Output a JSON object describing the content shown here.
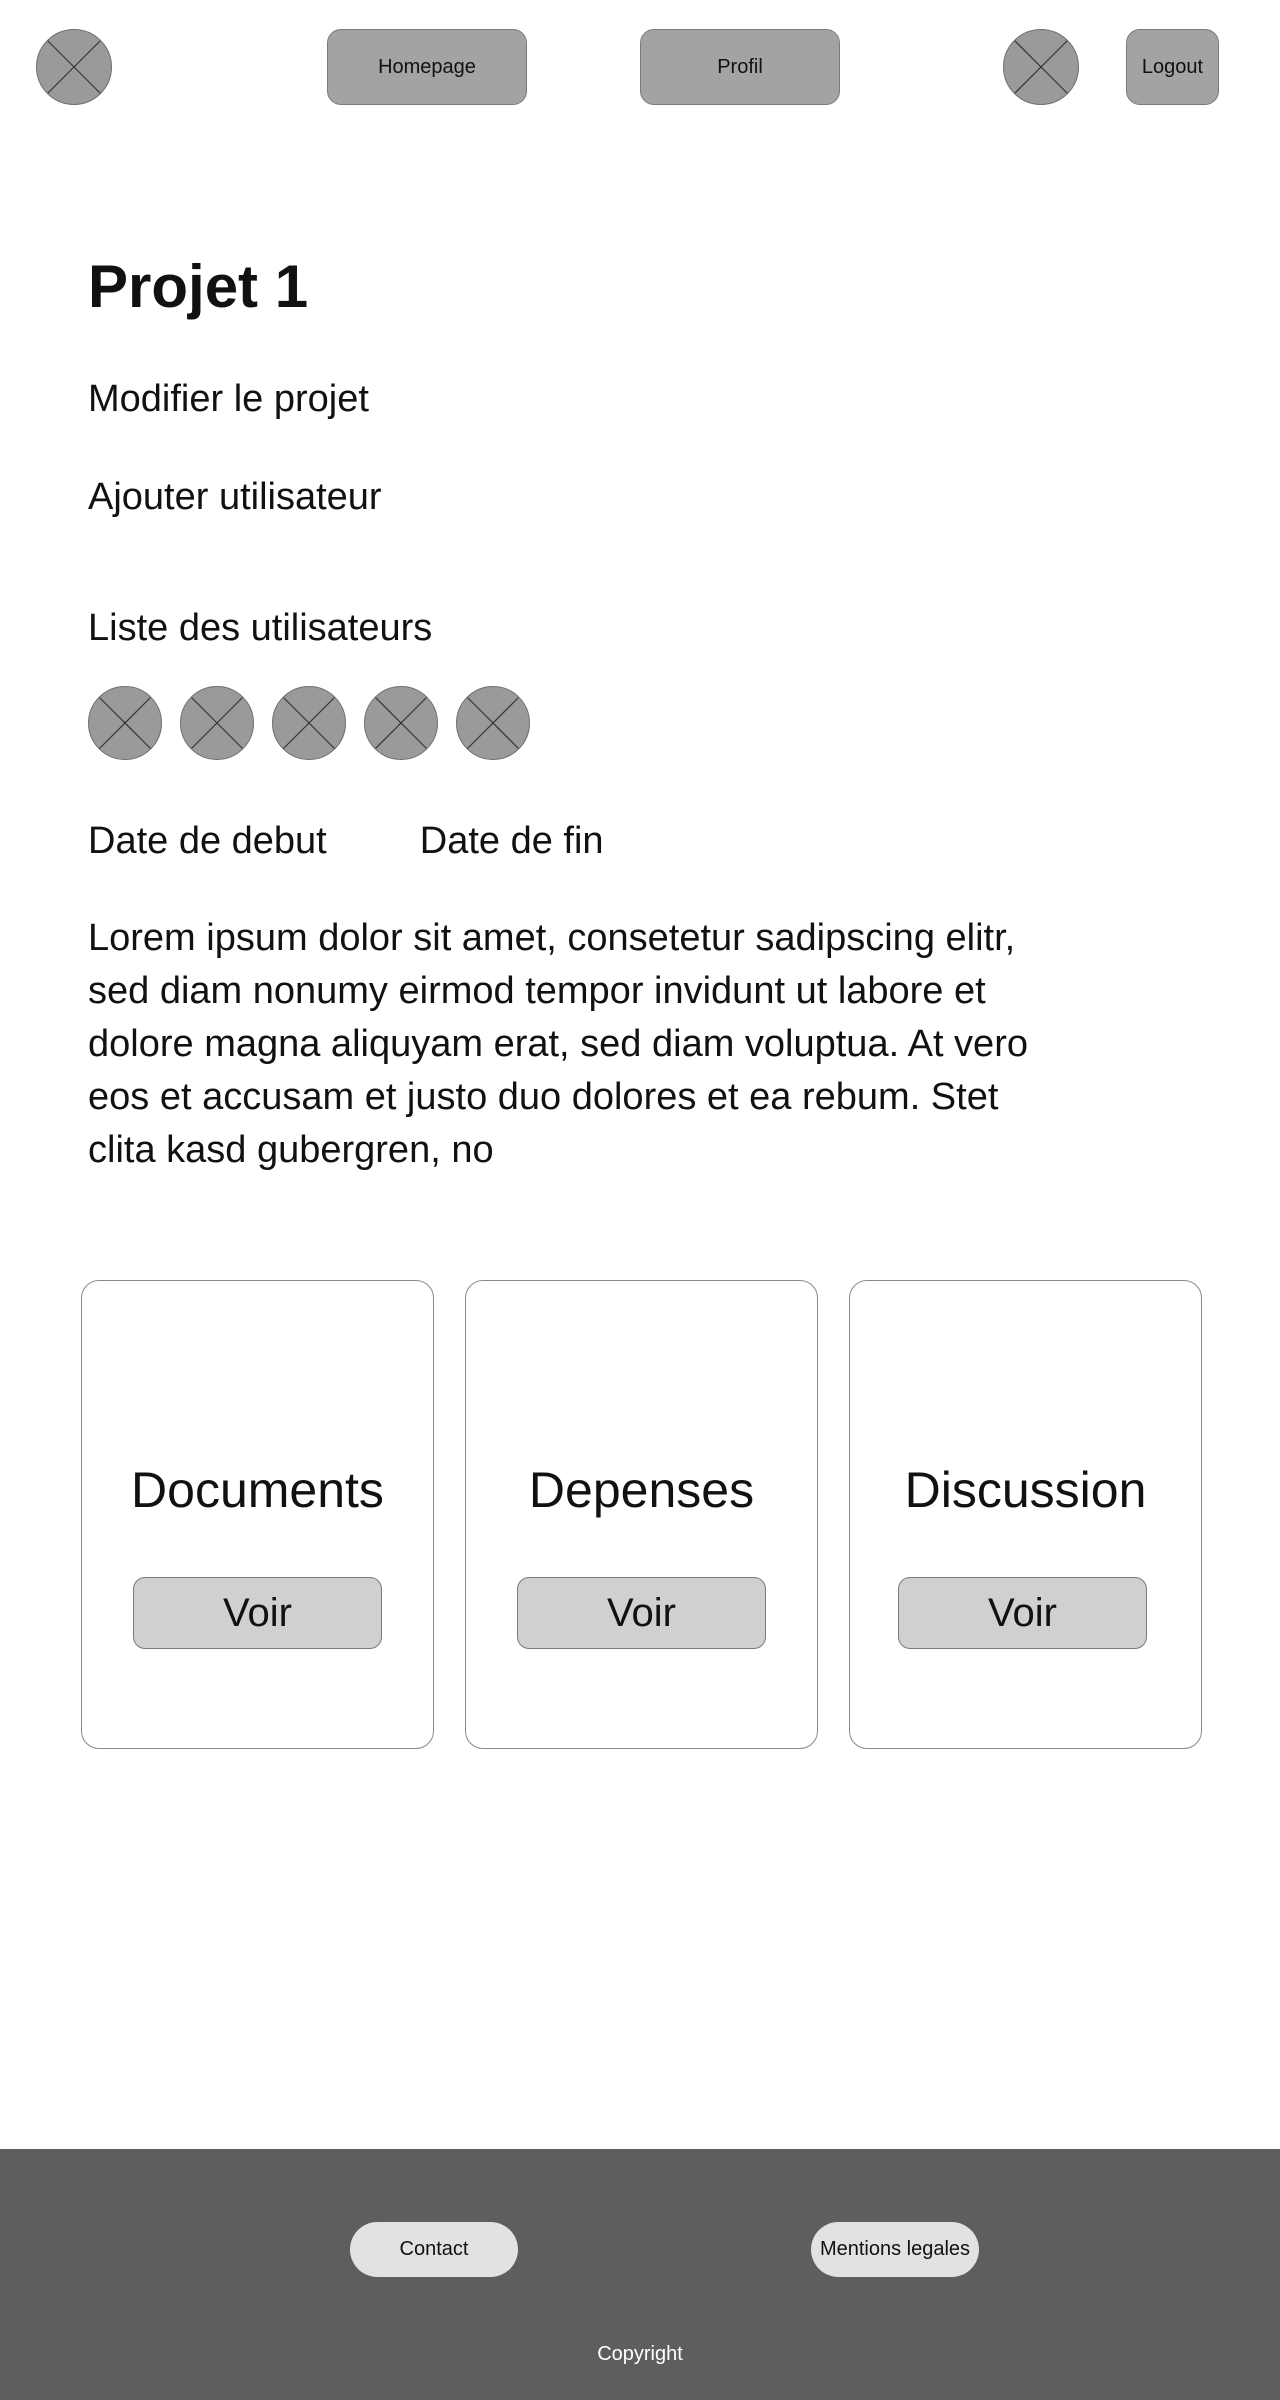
{
  "header": {
    "logo_icon": "image-placeholder-icon",
    "nav": {
      "homepage": "Homepage",
      "profil": "Profil"
    },
    "avatar_icon": "image-placeholder-icon",
    "logout": "Logout"
  },
  "project": {
    "title": "Projet 1",
    "edit_link": "Modifier le projet",
    "add_user_link": "Ajouter utilisateur",
    "users_heading": "Liste des utilisateurs",
    "users_count_shown": 5,
    "start_date_label": "Date de debut",
    "end_date_label": "Date de fin",
    "description": "Lorem ipsum dolor sit amet, consetetur sadipscing elitr, sed diam nonumy eirmod tempor invidunt ut labore et dolore magna aliquyam erat, sed diam voluptua. At vero eos et accusam et justo duo dolores et ea rebum. Stet clita kasd gubergren, no"
  },
  "cards": [
    {
      "title": "Documents",
      "button": "Voir"
    },
    {
      "title": "Depenses",
      "button": "Voir"
    },
    {
      "title": "Discussion",
      "button": "Voir"
    }
  ],
  "footer": {
    "contact": "Contact",
    "legal": "Mentions legales",
    "copyright": "Copyright"
  },
  "colors": {
    "placeholder_fill": "#9a9a9a",
    "nav_button_bg": "#a3a3a3",
    "card_button_bg": "#d0d0d0",
    "footer_bg": "#5e5e5e",
    "footer_button_bg": "#e2e2e2"
  }
}
